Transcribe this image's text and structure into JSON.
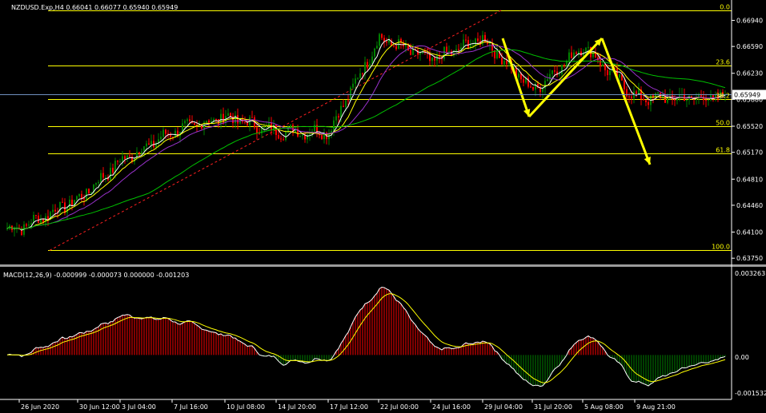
{
  "main_chart": {
    "header": "NZDUSD.Exp,H4  0.66041 0.66077 0.65940 0.65949",
    "current_price": "0.65949",
    "price_ticks": [
      "0.66940",
      "0.66590",
      "0.66230",
      "0.65880",
      "0.65520",
      "0.65170",
      "0.64810",
      "0.64460",
      "0.64100",
      "0.63750"
    ],
    "fib_levels": [
      {
        "label": "0.0",
        "price": 0.67075
      },
      {
        "label": "23.6",
        "price": 0.66338
      },
      {
        "label": "38.2",
        "price": 0.65882
      },
      {
        "label": "50.0",
        "price": 0.65519
      },
      {
        "label": "61.8",
        "price": 0.65152
      },
      {
        "label": "100.0",
        "price": 0.63855
      }
    ],
    "price_range": [
      0.6372,
      0.6717
    ],
    "colors": {
      "bull": "#008000",
      "bear": "#ff0000",
      "fib": "#ffff00",
      "current": "#6f8fbf",
      "ma_fast": "#ffffff",
      "ma_mid": "#ffff00",
      "ma_slow": "#9932cc",
      "ma_long": "#00c000",
      "arrow": "#ffff00"
    }
  },
  "macd": {
    "header": "MACD(12,26,9) -0.000999 -0.000073 0.000000 -0.001203",
    "ticks": [
      "0.003263",
      "0.00",
      "-0.001532"
    ],
    "range": [
      -0.00165,
      0.0034
    ]
  },
  "time_axis": {
    "labels": [
      "26 Jun 2020",
      "30 Jun 12:00",
      "3 Jul 04:00",
      "7 Jul 16:00",
      "10 Jul 08:00",
      "14 Jul 20:00",
      "17 Jul 12:00",
      "22 Jul 00:00",
      "24 Jul 16:00",
      "29 Jul 04:00",
      "31 Jul 20:00",
      "5 Aug 08:00",
      "9 Aug 21:00"
    ]
  },
  "chart_data": {
    "type": "candlestick",
    "symbol": "NZDUSD.Exp",
    "timeframe": "H4",
    "ohlc_last": {
      "open": 0.66041,
      "high": 0.66077,
      "low": 0.6594,
      "close": 0.65949
    },
    "x": [
      "26 Jun 2020",
      "30 Jun 12:00",
      "3 Jul 04:00",
      "7 Jul 16:00",
      "10 Jul 08:00",
      "14 Jul 20:00",
      "17 Jul 12:00",
      "22 Jul 00:00",
      "24 Jul 16:00",
      "29 Jul 04:00",
      "31 Jul 20:00",
      "5 Aug 08:00",
      "9 Aug 21:00"
    ],
    "approx_close_at_labels": [
      0.6415,
      0.6455,
      0.6505,
      0.6545,
      0.6565,
      0.6545,
      0.6545,
      0.667,
      0.664,
      0.667,
      0.66,
      0.666,
      0.659
    ],
    "ylim": [
      0.6375,
      0.6694
    ],
    "macd_ylim": [
      -0.001532,
      0.003263
    ]
  }
}
